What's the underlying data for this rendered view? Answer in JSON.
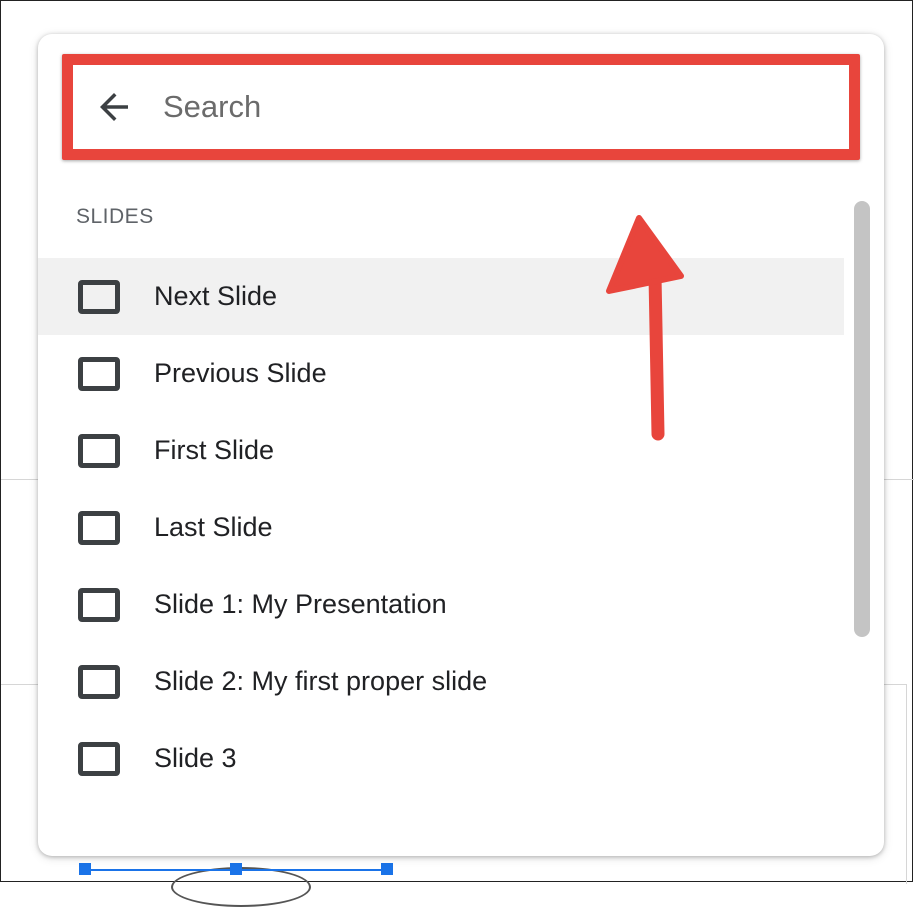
{
  "search": {
    "placeholder": "Search",
    "value": ""
  },
  "section": {
    "title": "SLIDES"
  },
  "items": [
    {
      "label": "Next Slide",
      "icon": "slide-icon",
      "highlighted": true
    },
    {
      "label": "Previous Slide",
      "icon": "slide-icon"
    },
    {
      "label": "First Slide",
      "icon": "slide-icon"
    },
    {
      "label": "Last Slide",
      "icon": "slide-icon"
    },
    {
      "label": "Slide 1: My Presentation",
      "icon": "slide-icon"
    },
    {
      "label": "Slide 2: My first proper slide",
      "icon": "slide-icon"
    },
    {
      "label": "Slide 3",
      "icon": "slide-icon"
    }
  ],
  "colors": {
    "highlight_border": "#e8453c",
    "annotation_arrow": "#e8453c",
    "hover_row": "#f1f1f1",
    "selection_handles": "#1a73e8"
  }
}
